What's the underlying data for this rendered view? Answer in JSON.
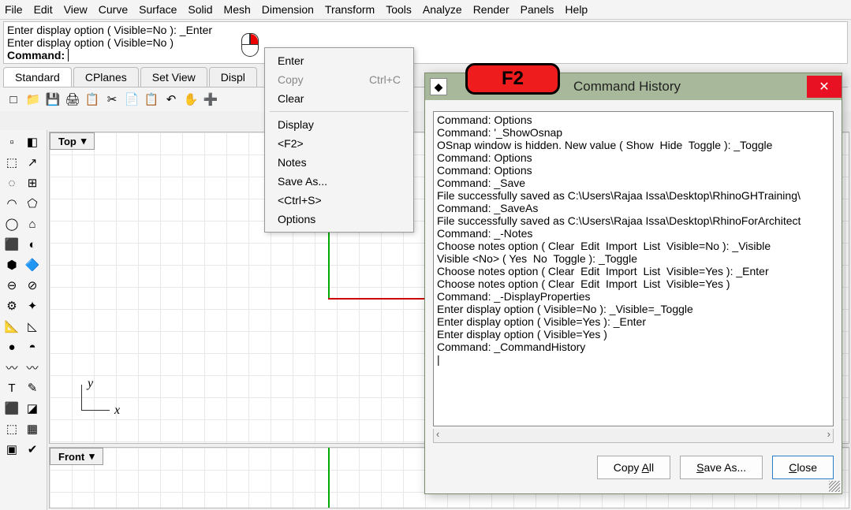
{
  "menubar": [
    "File",
    "Edit",
    "View",
    "Curve",
    "Surface",
    "Solid",
    "Mesh",
    "Dimension",
    "Transform",
    "Tools",
    "Analyze",
    "Render",
    "Panels",
    "Help"
  ],
  "cmd": {
    "line1": "Enter display option ( Visible=No ): _Enter",
    "line2": "Enter display option ( Visible=No )",
    "prompt": "Command:",
    "value": ""
  },
  "tabs": [
    "Standard",
    "CPlanes",
    "Set View",
    "Displ"
  ],
  "toolbar_icons": [
    "□",
    "📁",
    "💾",
    "🖨",
    "📋",
    "✂",
    "📄",
    "📋",
    "↶",
    "✋",
    "➕"
  ],
  "side_icons": [
    [
      "▫",
      "◧"
    ],
    [
      "⬚",
      "↗"
    ],
    [
      "◌",
      "⊞"
    ],
    [
      "◠",
      "⬠"
    ],
    [
      "◯",
      "⌂"
    ],
    [
      "⬛",
      "◐"
    ],
    [
      "⬢",
      "🔷"
    ],
    [
      "⊖",
      "⊘"
    ],
    [
      "⚙",
      "✦"
    ],
    [
      "📐",
      "◺"
    ],
    [
      "●",
      "◓"
    ],
    [
      "〰",
      "〰"
    ],
    [
      "T",
      "✎"
    ],
    [
      "⬛",
      "◪"
    ],
    [
      "⬚",
      "▦"
    ],
    [
      "▣",
      "✔"
    ]
  ],
  "viewport_top": "Top",
  "viewport_front": "Front",
  "axis_x": "x",
  "axis_y": "y",
  "context_menu": {
    "enter": "Enter",
    "copy": "Copy",
    "copy_shortcut": "Ctrl+C",
    "clear": "Clear",
    "display": "Display",
    "f2": "<F2>",
    "notes": "Notes",
    "saveas": "Save As...",
    "ctrls": "<Ctrl+S>",
    "options": "Options"
  },
  "f2_badge": "F2",
  "dialog": {
    "title": "Command History",
    "icon": "◆",
    "content": "Command: Options\nCommand: '_ShowOsnap\nOSnap window is hidden. New value ( Show  Hide  Toggle ): _Toggle\nCommand: Options\nCommand: Options\nCommand: _Save\nFile successfully saved as C:\\Users\\Rajaa Issa\\Desktop\\RhinoGHTraining\\\nCommand: _SaveAs\nFile successfully saved as C:\\Users\\Rajaa Issa\\Desktop\\RhinoForArchitect\nCommand: _-Notes\nChoose notes option ( Clear  Edit  Import  List  Visible=No ): _Visible\nVisible <No> ( Yes  No  Toggle ): _Toggle\nChoose notes option ( Clear  Edit  Import  List  Visible=Yes ): _Enter\nChoose notes option ( Clear  Edit  Import  List  Visible=Yes )\nCommand: _-DisplayProperties\nEnter display option ( Visible=No ): _Visible=_Toggle\nEnter display option ( Visible=Yes ): _Enter\nEnter display option ( Visible=Yes )\nCommand: _CommandHistory\n|",
    "copyall": "Copy All",
    "copyall_ak": "A",
    "saveas": "Save As...",
    "saveas_ak": "S",
    "close": "Close",
    "close_ak": "C"
  }
}
